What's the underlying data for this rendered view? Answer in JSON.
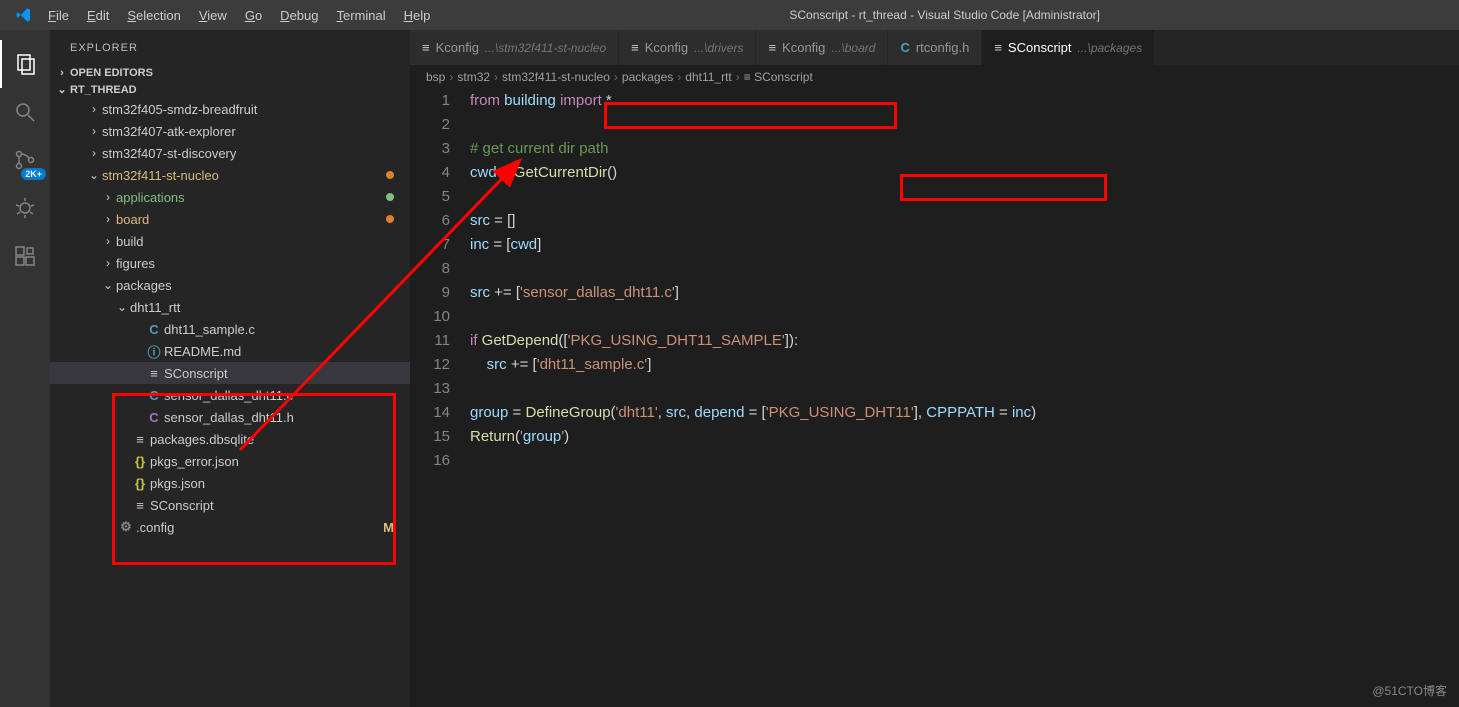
{
  "title": "SConscript - rt_thread - Visual Studio Code [Administrator]",
  "menu": [
    "File",
    "Edit",
    "Selection",
    "View",
    "Go",
    "Debug",
    "Terminal",
    "Help"
  ],
  "sidebar": {
    "title": "EXPLORER",
    "open_editors": "OPEN EDITORS",
    "workspace": "RT_THREAD",
    "scm_badge": "2K+"
  },
  "tree": {
    "items": [
      {
        "indent": 2,
        "chev": "›",
        "label": "stm32f405-smdz-breadfruit"
      },
      {
        "indent": 2,
        "chev": "›",
        "label": "stm32f407-atk-explorer"
      },
      {
        "indent": 2,
        "chev": "›",
        "label": "stm32f407-st-discovery"
      },
      {
        "indent": 2,
        "chev": "⌄",
        "label": "stm32f411-st-nucleo",
        "cls": "folder-orange",
        "dot": "dot-orange"
      },
      {
        "indent": 3,
        "chev": "›",
        "label": "applications",
        "cls": "folder-green",
        "dot": "dot-green"
      },
      {
        "indent": 3,
        "chev": "›",
        "label": "board",
        "cls": "folder-orange",
        "dot": "dot-orange"
      },
      {
        "indent": 3,
        "chev": "›",
        "label": "build"
      },
      {
        "indent": 3,
        "chev": "›",
        "label": "figures"
      },
      {
        "indent": 3,
        "chev": "⌄",
        "label": "packages"
      },
      {
        "indent": 4,
        "chev": "⌄",
        "label": "dht11_rtt"
      },
      {
        "indent": 5,
        "icon": "C",
        "iconCls": "icon-c",
        "label": "dht11_sample.c"
      },
      {
        "indent": 5,
        "icon": "ⓘ",
        "iconCls": "icon-info",
        "label": "README.md"
      },
      {
        "indent": 5,
        "icon": "≡",
        "iconCls": "icon-lines",
        "label": "SConscript",
        "selected": true
      },
      {
        "indent": 5,
        "icon": "C",
        "iconCls": "icon-c",
        "label": "sensor_dallas_dht11.c"
      },
      {
        "indent": 5,
        "icon": "C",
        "iconCls": "icon-h",
        "label": "sensor_dallas_dht11.h"
      },
      {
        "indent": 4,
        "icon": "≡",
        "iconCls": "icon-lines",
        "label": "packages.dbsqlite"
      },
      {
        "indent": 4,
        "icon": "{}",
        "iconCls": "icon-braces",
        "label": "pkgs_error.json"
      },
      {
        "indent": 4,
        "icon": "{}",
        "iconCls": "icon-braces",
        "label": "pkgs.json"
      },
      {
        "indent": 4,
        "icon": "≡",
        "iconCls": "icon-lines",
        "label": "SConscript"
      },
      {
        "indent": 3,
        "icon": "⚙",
        "iconCls": "icon-gear",
        "label": ".config",
        "status": "M"
      }
    ]
  },
  "tabs": [
    {
      "icon": "≡",
      "iconCls": "icon-lines",
      "label": "Kconfig",
      "path": "...\\stm32f411-st-nucleo"
    },
    {
      "icon": "≡",
      "iconCls": "icon-lines",
      "label": "Kconfig",
      "path": "...\\drivers"
    },
    {
      "icon": "≡",
      "iconCls": "icon-lines",
      "label": "Kconfig",
      "path": "...\\board"
    },
    {
      "icon": "C",
      "iconCls": "icon-c",
      "label": "rtconfig.h",
      "path": ""
    },
    {
      "icon": "≡",
      "iconCls": "icon-lines",
      "label": "SConscript",
      "path": "...\\packages",
      "active": true
    }
  ],
  "breadcrumb": [
    "bsp",
    "stm32",
    "stm32f411-st-nucleo",
    "packages",
    "dht11_rtt",
    "≡ SConscript"
  ],
  "code": {
    "lines": [
      "from building import *",
      "",
      "# get current dir path",
      "cwd = GetCurrentDir()",
      "",
      "src = []",
      "inc = [cwd]",
      "",
      "src += ['sensor_dallas_dht11.c']",
      "",
      "if GetDepend(['PKG_USING_DHT11_SAMPLE']):",
      "    src += ['dht11_sample.c']",
      "",
      "group = DefineGroup('dht11', src, depend = ['PKG_USING_DHT11'], CPPPATH = inc)",
      "Return('group')",
      ""
    ]
  },
  "watermark": "@51CTO博客"
}
